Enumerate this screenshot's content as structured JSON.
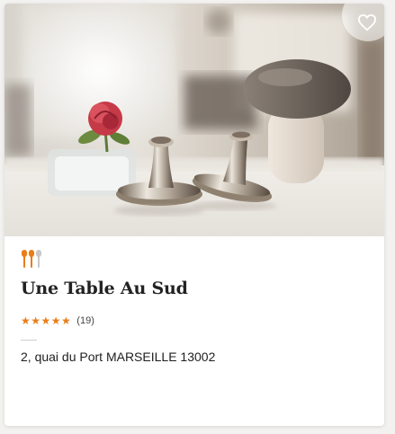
{
  "restaurant": {
    "name": "Une Table Au Sud",
    "rating_stars": "★★★★★",
    "rating_value": 5,
    "review_count": "(19)",
    "address": "2, quai du Port MARSEILLE 13002",
    "price_level": 2,
    "price_max": 3
  },
  "icons": {
    "favorite": "heart-outline-icon",
    "price": "cutlery-icon"
  },
  "colors": {
    "accent": "#ea7d17",
    "price_inactive": "#c8c8c8",
    "text": "#222222"
  }
}
